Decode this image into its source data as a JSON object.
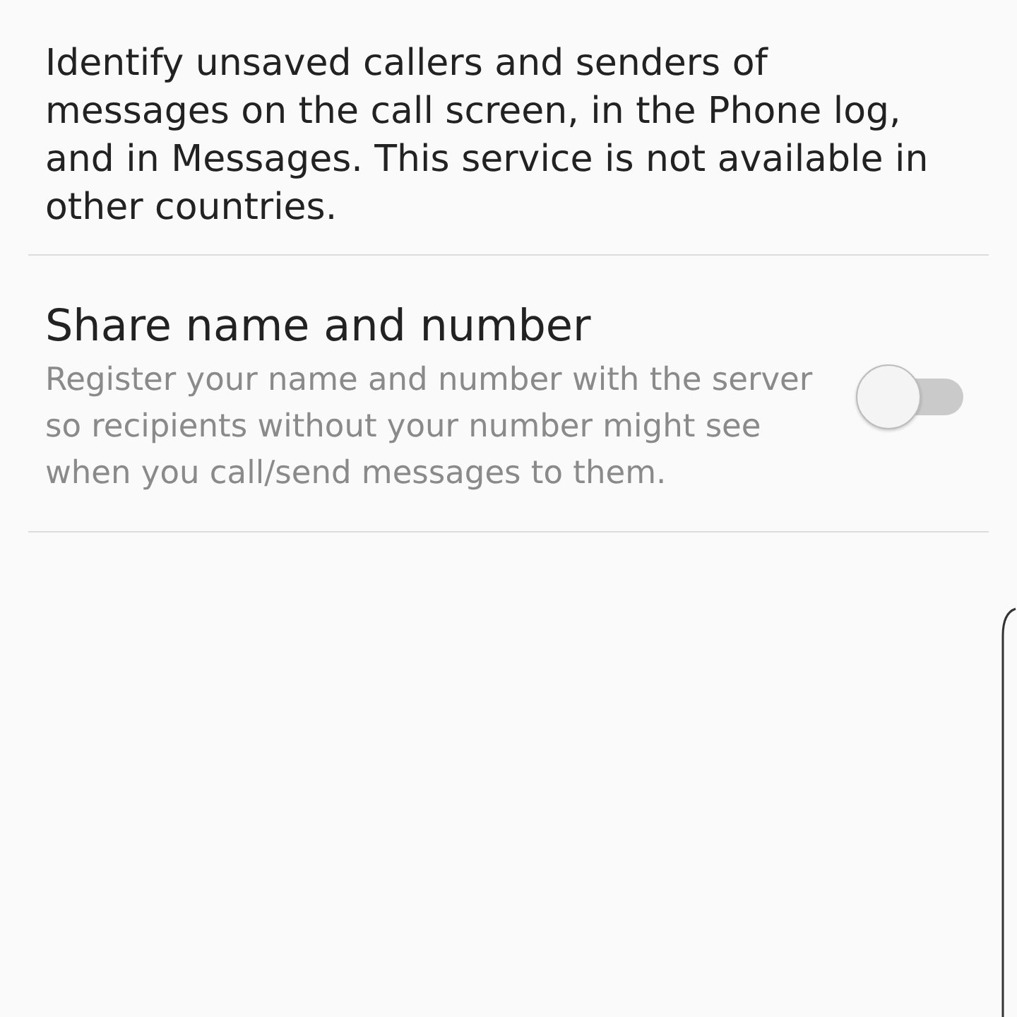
{
  "intro_text": "Identify unsaved callers and senders of messages on the call screen, in the Phone log, and in Messages. This service is not available in other countries.",
  "settings": [
    {
      "title": "Share name and number",
      "description": "Register your name and number with the server so recipients without your number might see when you call/send messages to them.",
      "on": false
    }
  ]
}
